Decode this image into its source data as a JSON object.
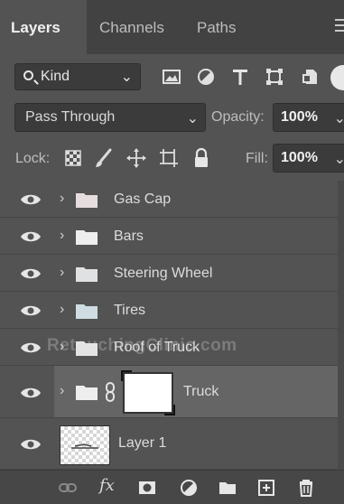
{
  "tabs": [
    {
      "label": "Layers",
      "active": true
    },
    {
      "label": "Channels",
      "active": false
    },
    {
      "label": "Paths",
      "active": false
    }
  ],
  "filter": {
    "kind_label": "Kind",
    "icons": [
      "image-filter-icon",
      "adjustment-filter-icon",
      "type-filter-icon",
      "shape-filter-icon",
      "smart-object-filter-icon"
    ]
  },
  "blend": {
    "mode": "Pass Through",
    "opacity_label": "Opacity:",
    "opacity_value": "100%"
  },
  "lock": {
    "label": "Lock:",
    "fill_label": "Fill:",
    "fill_value": "100%"
  },
  "layers": [
    {
      "name": "Gas Cap",
      "type": "group"
    },
    {
      "name": "Bars",
      "type": "group"
    },
    {
      "name": "Steering Wheel",
      "type": "group"
    },
    {
      "name": "Tires",
      "type": "group"
    },
    {
      "name": "Roof of Truck",
      "type": "group"
    },
    {
      "name": "Truck",
      "type": "group-masked",
      "selected": true
    },
    {
      "name": "Layer 1",
      "type": "pixel"
    }
  ],
  "watermark": "RetouchingClinic.com",
  "colors": {
    "panel": "#535353",
    "tabbar": "#424242",
    "selected_row": "#656565"
  }
}
